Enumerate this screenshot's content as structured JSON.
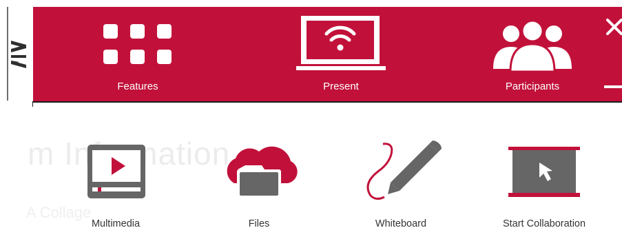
{
  "header": {
    "nav": [
      {
        "label": "Features",
        "icon": "grid-icon"
      },
      {
        "label": "Present",
        "icon": "laptop-wifi-icon"
      },
      {
        "label": "Participants",
        "icon": "participants-icon"
      }
    ],
    "close_icon": "close-icon",
    "minimize_icon": "minimize-icon"
  },
  "background": {
    "title": "m Information",
    "subtitle": "A Collage"
  },
  "tools": [
    {
      "label": "Multimedia",
      "icon": "multimedia-icon"
    },
    {
      "label": "Files",
      "icon": "cloud-files-icon"
    },
    {
      "label": "Whiteboard",
      "icon": "whiteboard-pen-icon"
    },
    {
      "label": "Start Collaboration",
      "icon": "collaboration-screen-icon"
    }
  ],
  "colors": {
    "brand": "#c1113a",
    "icon_gray": "#666666",
    "text": "#333333"
  }
}
